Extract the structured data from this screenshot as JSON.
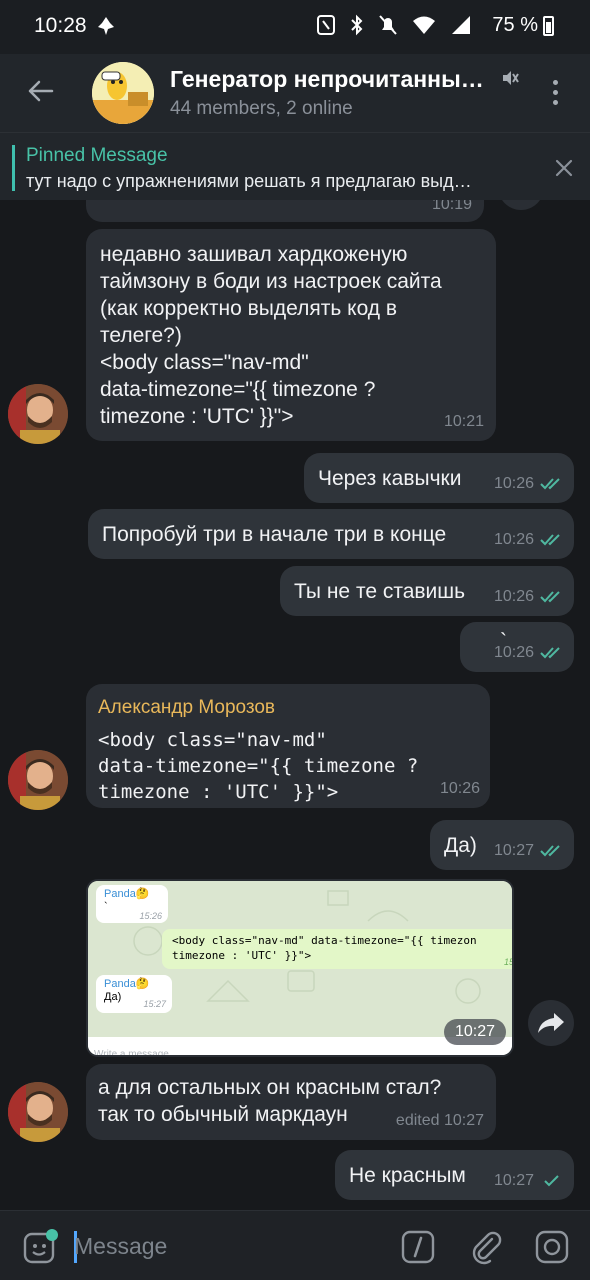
{
  "status_bar": {
    "time": "10:28",
    "battery": "75 %"
  },
  "header": {
    "title": "Генератор непрочитанны…",
    "subtitle": "44 members, 2 online"
  },
  "pinned": {
    "title": "Pinned Message",
    "text": "тут надо с упражнениями решать я предлагаю выд…"
  },
  "messages": [
    {
      "time": "10:19"
    },
    {
      "text_lines": [
        "недавно зашивал хардкоженую",
        "таймзону в боди из настроек сайта",
        "(как корректно выделять код в",
        "телеге?)",
        "<body class=\"nav-md\"",
        "data-timezone=\"{{ timezone ?",
        "timezone : 'UTC' }}\">"
      ],
      "time": "10:21"
    },
    {
      "text": "Через кавычки",
      "time": "10:26"
    },
    {
      "text": "Попробуй три в начале три в конце",
      "time": "10:26"
    },
    {
      "text": "Ты не те ставишь",
      "time": "10:26"
    },
    {
      "text": "`",
      "time": "10:26"
    },
    {
      "sender": "Александр Морозов",
      "code_lines": [
        "<body class=\"nav-md\"",
        "data-timezone=\"{{ timezone ?",
        "timezone : 'UTC' }}\">"
      ],
      "time": "10:26"
    },
    {
      "text": "Да)",
      "time": "10:27"
    },
    {
      "photo": {
        "sender1": "Panda🤔",
        "msg1": "`",
        "time1": "15:26",
        "code1": "<body class=\"nav-md\" data-timezone=\"{{ timezon",
        "code2": "timezone : 'UTC' }}\">",
        "code_time": "15",
        "sender2": "Panda🤔",
        "msg2": "Да)",
        "time2": "15:27",
        "input_placeholder": "Write a message"
      },
      "time": "10:27"
    },
    {
      "text_lines": [
        "а для остальных он красным стал?",
        "так то обычный маркдаун"
      ],
      "time": "edited 10:27"
    },
    {
      "text": "Не красным",
      "time": "10:27"
    }
  ],
  "input": {
    "placeholder": "Message"
  },
  "colors": {
    "accent": "#48c2a7",
    "sender": "#e9b85a",
    "tick": "#4fb8a0"
  }
}
